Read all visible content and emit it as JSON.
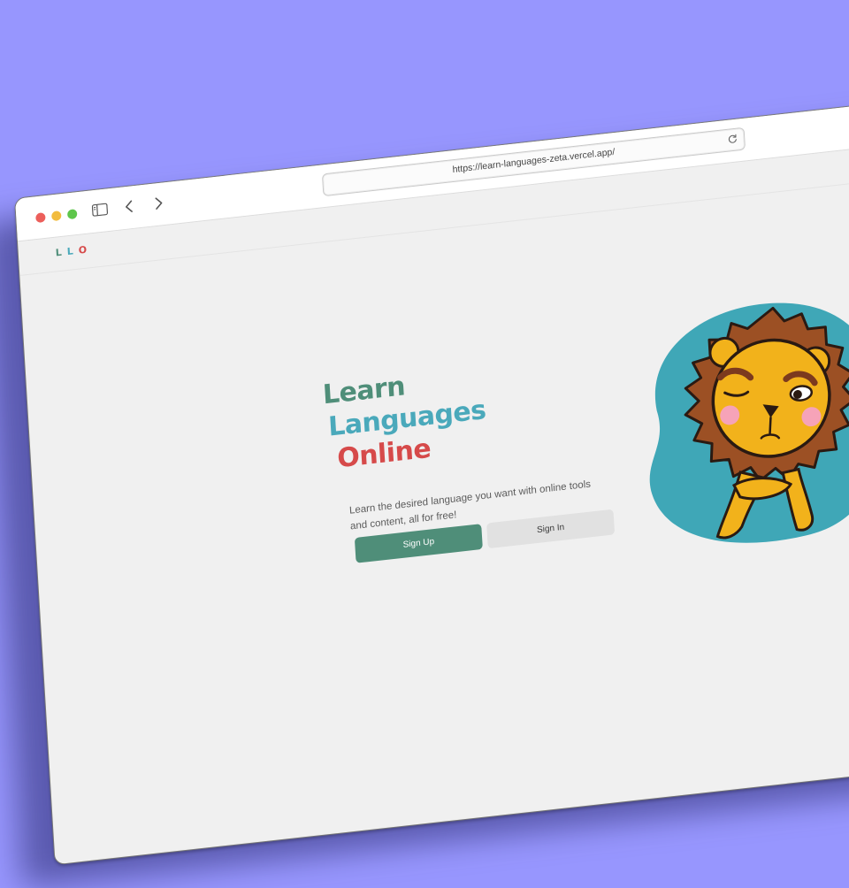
{
  "browser": {
    "url": "https://learn-languages-zeta.vercel.app/",
    "traffic_lights": {
      "close": "#ec5f5b",
      "minimize": "#f2bc3e",
      "maximize": "#5ec64b"
    },
    "icons": {
      "sidebar": "sidebar-icon",
      "back": "chevron-left-icon",
      "forward": "chevron-right-icon",
      "reload": "reload-icon"
    }
  },
  "site": {
    "logo": {
      "letters": [
        "L",
        "L",
        "O"
      ],
      "colors": [
        "#4f8e79",
        "#4aa9bb",
        "#d64a4a"
      ]
    },
    "hero": {
      "title_lines": [
        {
          "text": "Learn",
          "color": "#4f8e79"
        },
        {
          "text": "Languages",
          "color": "#4aa9bb"
        },
        {
          "text": "Online",
          "color": "#d64a4a"
        }
      ],
      "description": "Learn the desired language you want with online tools and content, all for free!",
      "signup_label": "Sign Up",
      "signin_label": "Sign In",
      "mascot": "lion-mascot-illustration",
      "mascot_bg": "#3fa7b7"
    }
  },
  "background_color": "#9796fe"
}
